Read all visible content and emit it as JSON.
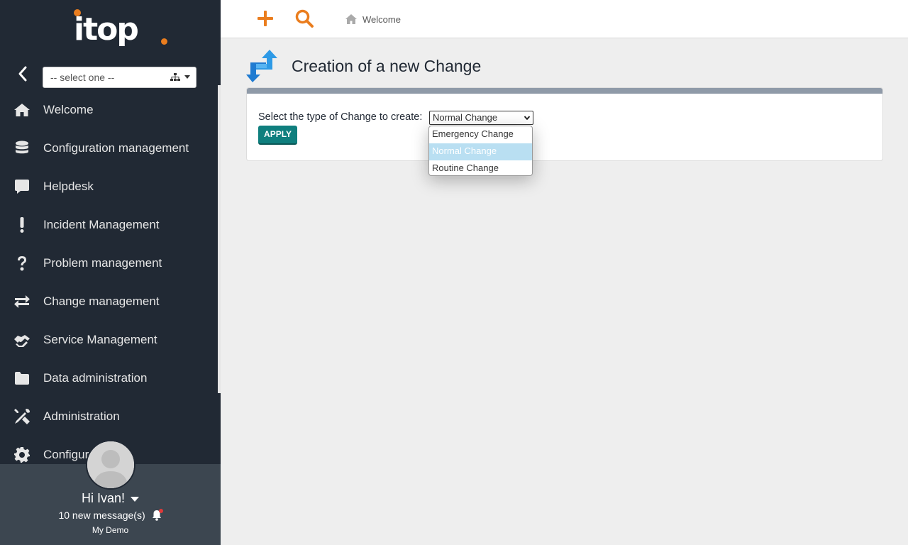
{
  "app": {
    "logo_text": "itop"
  },
  "sidebar": {
    "org_select": {
      "value": "-- select one --"
    },
    "items": [
      {
        "label": "Welcome",
        "icon": "home-icon"
      },
      {
        "label": "Configuration management",
        "icon": "database-icon"
      },
      {
        "label": "Helpdesk",
        "icon": "comment-icon"
      },
      {
        "label": "Incident Management",
        "icon": "exclamation-icon"
      },
      {
        "label": "Problem management",
        "icon": "question-icon"
      },
      {
        "label": "Change management",
        "icon": "exchange-arrows-icon"
      },
      {
        "label": "Service Management",
        "icon": "handshake-icon"
      },
      {
        "label": "Data administration",
        "icon": "folder-icon"
      },
      {
        "label": "Administration",
        "icon": "tools-icon"
      },
      {
        "label": "Configur",
        "icon": "cog-icon"
      }
    ]
  },
  "user": {
    "greeting": "Hi Ivan!",
    "messages": "10 new message(s)",
    "organization": "My Demo"
  },
  "topbar": {
    "breadcrumb": "Welcome"
  },
  "page": {
    "title": "Creation of a new Change",
    "form_label": "Select the type of Change to create:",
    "selected_type": "Normal Change",
    "apply_label": "APPLY",
    "options": [
      "Emergency Change",
      "Normal Change",
      "Routine Change"
    ],
    "highlighted_option": "Normal Change"
  },
  "colors": {
    "sidebar_bg": "#212934",
    "accent": "#ea7d1e",
    "apply_button": "#0f7f7e",
    "panel_bar": "#8f9aa8",
    "option_highlight": "#b9dff2"
  }
}
